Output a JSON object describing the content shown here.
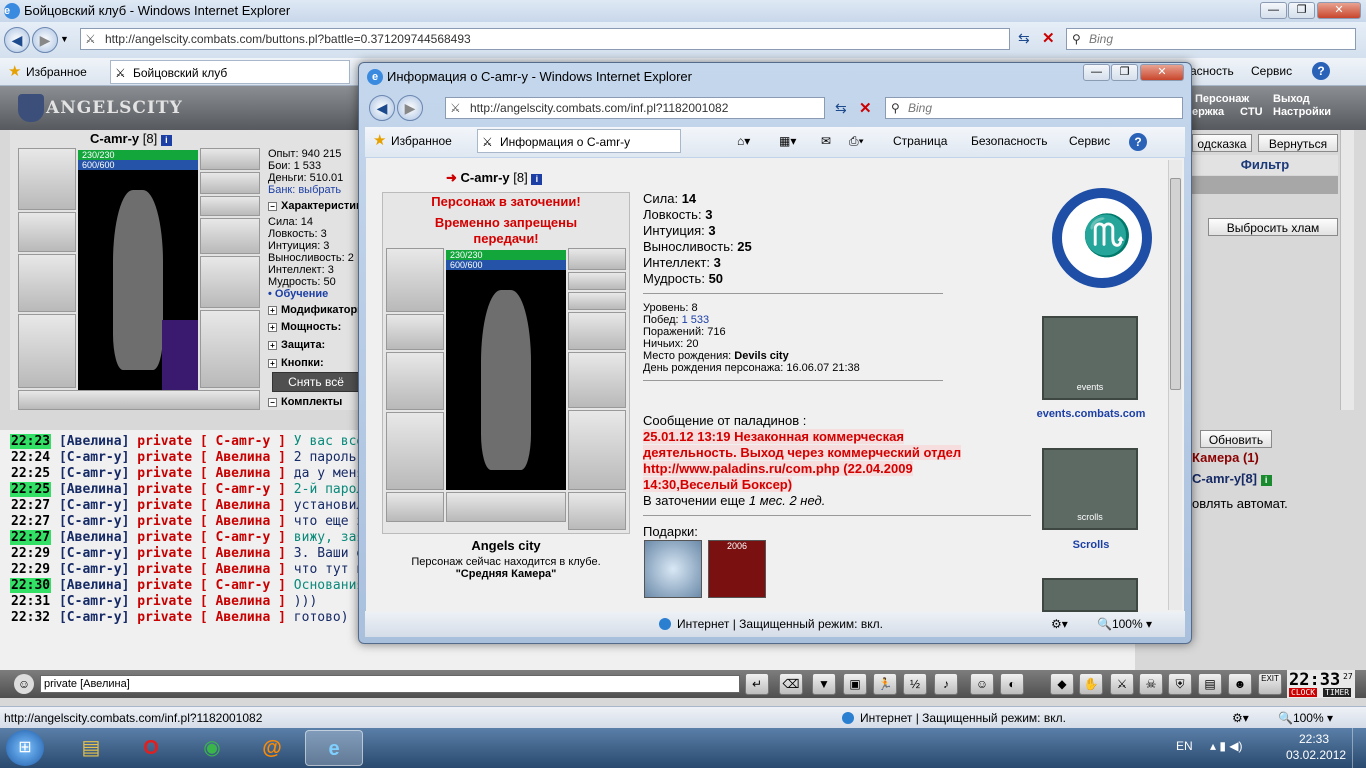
{
  "main_window": {
    "title": "Бойцовский клуб - Windows Internet Explorer",
    "url": "http://angelscity.combats.com/buttons.pl?battle=0.371209744568493",
    "search_placeholder": "Bing",
    "favorites_label": "Избранное",
    "tab_label": "Бойцовский клуб",
    "menu_safety": "асность",
    "menu_service": "Сервис"
  },
  "game": {
    "logo": "ANGELSCITY",
    "top_links": [
      "Персонаж",
      "Выход",
      "ержка",
      "CTU",
      "Настройки"
    ],
    "character_name": "C-amr-y",
    "character_level": "[8]",
    "hp": "230/230",
    "mana": "600/600",
    "stats_lines": [
      "Опыт: 940 215",
      "Бои: 1 533",
      "Деньги: 510.01",
      "Банк: выбрать"
    ],
    "sections": [
      "Характеристики",
      "Модификаторы",
      "Мощность:",
      "Защита:",
      "Кнопки:",
      "Комплекты"
    ],
    "attr_lines": [
      "Сила: 14",
      "Ловкость: 3",
      "Интуиция: 3",
      "Выносливость: 2",
      "Интеллект: 3",
      "Мудрость: 50"
    ],
    "training_link": "• Обучение",
    "unequip_button": "Снять всё",
    "right_tabs": [
      "одсказка",
      "Вернуться"
    ],
    "filter_label": "Фильтр",
    "drop_junk_button": "Выбросить хлам",
    "refresh_button": "Обновить",
    "room_label": "Камера (1)",
    "right_nick": "C-amr-y[8]",
    "right_text": "овлять автомат."
  },
  "chat": {
    "lines": [
      {
        "time": "22:23",
        "hl": true,
        "from": "[Авелина]",
        "to": "private [ C-amr-y ]",
        "msg": "У вас все у",
        "green": true
      },
      {
        "time": "22:24",
        "hl": false,
        "from": "[C-amr-y]",
        "to": "private [ Авелина ]",
        "msg": "2 пароль уд",
        "green": false
      },
      {
        "time": "22:25",
        "hl": false,
        "from": "[C-amr-y]",
        "to": "private [ Авелина ]",
        "msg": "да у меня в",
        "green": false
      },
      {
        "time": "22:25",
        "hl": true,
        "from": "[Авелина]",
        "to": "private [ C-amr-y ]",
        "msg": "2-й пароль",
        "green": true
      },
      {
        "time": "22:27",
        "hl": false,
        "from": "[C-amr-y]",
        "to": "private [ Авелина ]",
        "msg": "установил",
        "green": false
      },
      {
        "time": "22:27",
        "hl": false,
        "from": "[C-amr-y]",
        "to": "private [ Авелина ]",
        "msg": "что еще зде",
        "green": false
      },
      {
        "time": "22:27",
        "hl": true,
        "from": "[Авелина]",
        "to": "private [ C-amr-y ]",
        "msg": "вижу, заяв",
        "green": true
      },
      {
        "time": "22:29",
        "hl": false,
        "from": "[C-amr-y]",
        "to": "private [ Авелина ]",
        "msg": "3. Ваши обо",
        "green": false
      },
      {
        "time": "22:29",
        "hl": false,
        "from": "[C-amr-y]",
        "to": "private [ Авелина ]",
        "msg": "что тут нап",
        "green": false
      },
      {
        "time": "22:30",
        "hl": true,
        "from": "[Авелина]",
        "to": "private [ C-amr-y ]",
        "msg": "Основания",
        "green": true
      },
      {
        "time": "22:31",
        "hl": false,
        "from": "[C-amr-y]",
        "to": "private [ Авелина ]",
        "msg": ")))",
        "green": false
      },
      {
        "time": "22:32",
        "hl": false,
        "from": "[C-amr-y]",
        "to": "private [ Авелина ]",
        "msg": "готово)",
        "green": false
      }
    ],
    "input_value": "private [Авелина]",
    "clock": "22:33",
    "clock_seconds": "27",
    "clock_label": "CLOCK",
    "timer_label": "TIMER",
    "exit_label": "EXIT"
  },
  "popup": {
    "title": "Информация о C-amr-y - Windows Internet Explorer",
    "url": "http://angelscity.combats.com/inf.pl?1182001082",
    "search_placeholder": "Bing",
    "favorites_label": "Избранное",
    "tab_label": "Информация о C-amr-y",
    "menu_page": "Страница",
    "menu_safety": "Безопасность",
    "menu_service": "Сервис",
    "char_name": "C-amr-y",
    "char_level": "[8]",
    "jail_line1": "Персонаж в заточении!",
    "jail_line2": "Временно запрещены",
    "jail_line3": "передачи!",
    "hp": "230/230",
    "mana": "600/600",
    "city": "Angels city",
    "location_line": "Персонаж сейчас находится в клубе.",
    "location_room": "\"Средняя Камера\"",
    "stats": [
      {
        "label": "Сила:",
        "value": "14"
      },
      {
        "label": "Ловкость:",
        "value": "3"
      },
      {
        "label": "Интуиция:",
        "value": "3"
      },
      {
        "label": "Выносливость:",
        "value": "25"
      },
      {
        "label": "Интеллект:",
        "value": "3"
      },
      {
        "label": "Мудрость:",
        "value": "50"
      }
    ],
    "level_line": "Уровень: 8",
    "wins_label": "Побед:",
    "wins_value": "1 533",
    "losses_line": "Поражений: 716",
    "draws_line": "Ничьих: 20",
    "birthplace_label": "Место рождения:",
    "birthplace_value": "Devils city",
    "birthday_line": "День рождения персонажа: 16.06.07 21:38",
    "paladin_title": "Сообщение от паладинов :",
    "paladin_msg1": "25.01.12 13:19 Незаконная коммерческая",
    "paladin_msg2": "деятельность. Выход через коммерческий отдел",
    "paladin_msg3": "http://www.paladins.ru/com.php (22.04.2009",
    "paladin_msg4": "14:30,Веселый Боксер)",
    "jail_remaining_label": "В заточении еще",
    "jail_remaining_value": "1 мес. 2 нед.",
    "gifts_label": "Подарки:",
    "gift_year": "2006",
    "events_label": "events.combats.com",
    "events_banner_text": "events",
    "scrolls_label": "Scrolls",
    "scrolls_banner_text": "scrolls",
    "status_text": "Интернет | Защищенный режим: вкл.",
    "zoom": "100%"
  },
  "status_bar": {
    "url": "http://angelscity.combats.com/inf.pl?1182001082",
    "zone": "Интернет | Защищенный режим: вкл.",
    "zoom": "100%"
  },
  "taskbar": {
    "lang": "EN",
    "time": "22:33",
    "date": "03.02.2012"
  }
}
